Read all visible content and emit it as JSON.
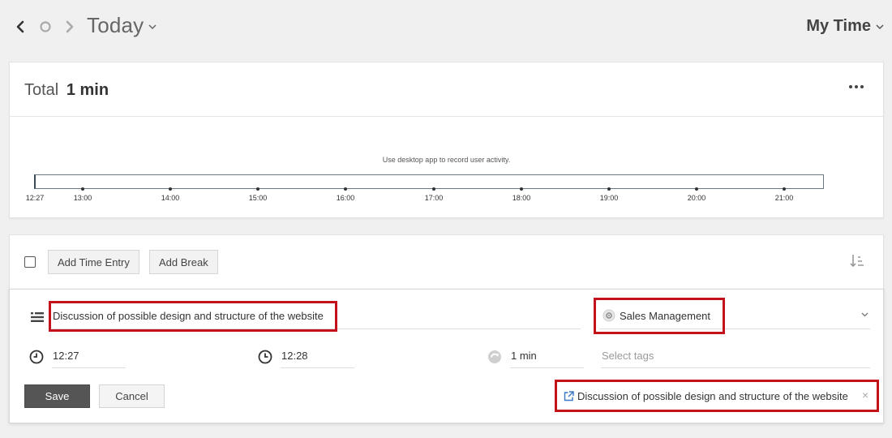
{
  "header": {
    "date_label": "Today",
    "user_menu": "My Time"
  },
  "summary": {
    "total_prefix": "Total",
    "total_value": "1 min",
    "activity_hint": "Use desktop app to record user activity.",
    "timeline_ticks": [
      "12:27",
      "13:00",
      "14:00",
      "15:00",
      "16:00",
      "17:00",
      "18:00",
      "19:00",
      "20:00",
      "21:00"
    ]
  },
  "toolbar": {
    "add_time_entry": "Add Time Entry",
    "add_break": "Add Break"
  },
  "entry": {
    "description": "Discussion of possible design and structure of the website",
    "project": "Sales Management",
    "start_time": "12:27",
    "end_time": "12:28",
    "duration": "1 min",
    "tags_placeholder": "Select tags",
    "save_label": "Save",
    "cancel_label": "Cancel",
    "linked_task": "Discussion of possible design and structure of the website",
    "linked_task_close": "×"
  },
  "colors": {
    "highlight": "#c4121c",
    "save_button": "#555555",
    "timeline_border": "#6b7780"
  },
  "icons": [
    "chevron-left-icon",
    "circle-icon",
    "chevron-right-icon",
    "chevron-down-icon",
    "more-dots-icon",
    "sort-icon",
    "description-icon",
    "project-icon",
    "clock-start-icon",
    "clock-end-icon",
    "duration-icon",
    "external-link-icon",
    "close-icon"
  ]
}
